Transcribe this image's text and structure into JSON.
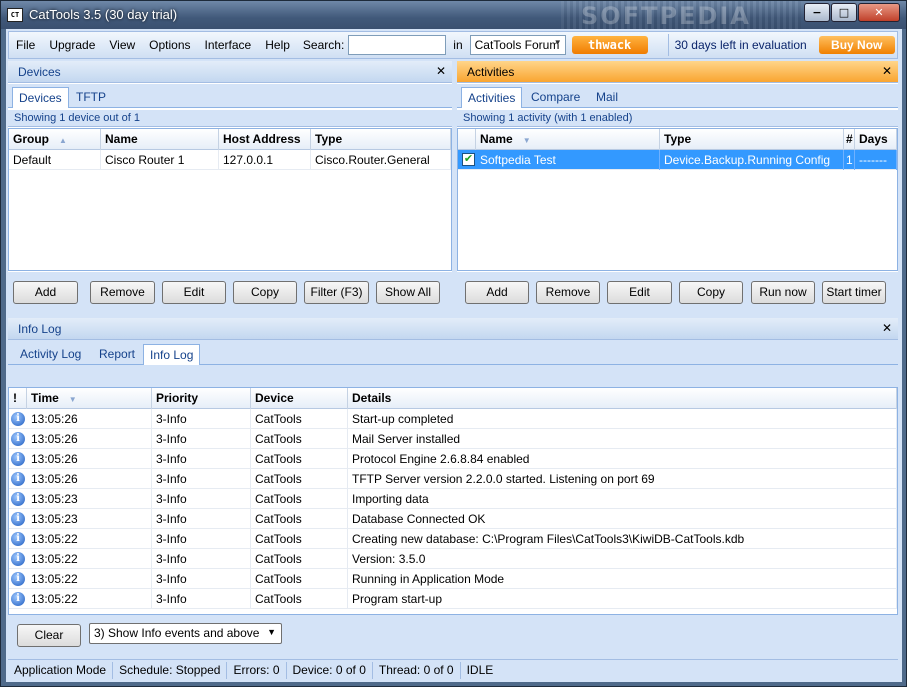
{
  "window": {
    "title": "CatTools 3.5 (30 day trial)",
    "icon_text": "CT",
    "watermark": "SOFTPEDIA",
    "minimize": "−",
    "maximize": "□",
    "close": "✕"
  },
  "menu": [
    "File",
    "Upgrade",
    "View",
    "Options",
    "Interface",
    "Help"
  ],
  "search": {
    "label": "Search:",
    "value": "",
    "in_label": "in",
    "scope": "CatTools Forum",
    "thwack": "thwack"
  },
  "evaluation": {
    "text": "30 days left in evaluation",
    "buy": "Buy Now"
  },
  "devices": {
    "title": "Devices",
    "tabs": [
      "Devices",
      "TFTP"
    ],
    "status": "Showing 1 device out of 1",
    "columns": [
      "Group",
      "Name",
      "Host Address",
      "Type"
    ],
    "rows": [
      {
        "group": "Default",
        "name": "Cisco Router 1",
        "host": "127.0.0.1",
        "type": "Cisco.Router.General"
      }
    ],
    "buttons": [
      "Add",
      "Remove",
      "Edit",
      "Copy",
      "Filter (F3)",
      "Show All"
    ]
  },
  "activities": {
    "title": "Activities",
    "tabs": [
      "Activities",
      "Compare",
      "Mail"
    ],
    "status": "Showing 1 activity (with 1 enabled)",
    "columns": [
      "Name",
      "Type",
      "#",
      "Days"
    ],
    "rows": [
      {
        "checked": "✔",
        "name": "Softpedia Test",
        "type": "Device.Backup.Running Config",
        "num": "1",
        "days": "-------"
      }
    ],
    "buttons": [
      "Add",
      "Remove",
      "Edit",
      "Copy",
      "Run now",
      "Start timer"
    ]
  },
  "infolog": {
    "title": "Info Log",
    "tabs": [
      "Activity Log",
      "Report",
      "Info Log"
    ],
    "columns": [
      "!",
      "Time",
      "Priority",
      "Device",
      "Details"
    ],
    "rows": [
      {
        "time": "13:05:26",
        "priority": "3-Info",
        "device": "CatTools",
        "details": "Start-up completed"
      },
      {
        "time": "13:05:26",
        "priority": "3-Info",
        "device": "CatTools",
        "details": "Mail Server installed"
      },
      {
        "time": "13:05:26",
        "priority": "3-Info",
        "device": "CatTools",
        "details": "Protocol Engine 2.6.8.84 enabled"
      },
      {
        "time": "13:05:26",
        "priority": "3-Info",
        "device": "CatTools",
        "details": "TFTP Server version 2.2.0.0 started. Listening on port 69"
      },
      {
        "time": "13:05:23",
        "priority": "3-Info",
        "device": "CatTools",
        "details": "Importing data"
      },
      {
        "time": "13:05:23",
        "priority": "3-Info",
        "device": "CatTools",
        "details": "Database Connected OK"
      },
      {
        "time": "13:05:22",
        "priority": "3-Info",
        "device": "CatTools",
        "details": "Creating new database: C:\\Program Files\\CatTools3\\KiwiDB-CatTools.kdb"
      },
      {
        "time": "13:05:22",
        "priority": "3-Info",
        "device": "CatTools",
        "details": "Version: 3.5.0"
      },
      {
        "time": "13:05:22",
        "priority": "3-Info",
        "device": "CatTools",
        "details": "Running in Application Mode"
      },
      {
        "time": "13:05:22",
        "priority": "3-Info",
        "device": "CatTools",
        "details": "Program start-up"
      }
    ],
    "clear": "Clear",
    "filter": "3) Show Info events and above"
  },
  "statusbar": [
    "Application Mode",
    "Schedule: Stopped",
    "Errors: 0",
    "Device: 0 of 0",
    "Thread: 0 of 0",
    "IDLE"
  ]
}
